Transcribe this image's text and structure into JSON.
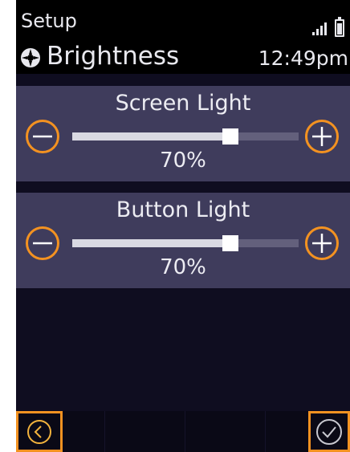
{
  "status_bar": {
    "title": "Setup",
    "signal_icon": "signal-bars-icon",
    "battery_icon": "battery-icon"
  },
  "header": {
    "icon": "settings-gear-icon",
    "title": "Brightness",
    "time": "12:49pm"
  },
  "sliders": [
    {
      "label": "Screen Light",
      "value_text": "70%",
      "level": 0.7,
      "minus_icon": "minus-icon",
      "plus_icon": "plus-icon"
    },
    {
      "label": "Button Light",
      "value_text": "70%",
      "level": 0.7,
      "minus_icon": "minus-icon",
      "plus_icon": "plus-icon"
    }
  ],
  "bottom_bar": {
    "back_icon": "chevron-left-icon",
    "confirm_icon": "checkmark-icon"
  },
  "colors": {
    "accent": "#f39221",
    "panel": "#3f3c5c",
    "background": "#0f0d20"
  }
}
